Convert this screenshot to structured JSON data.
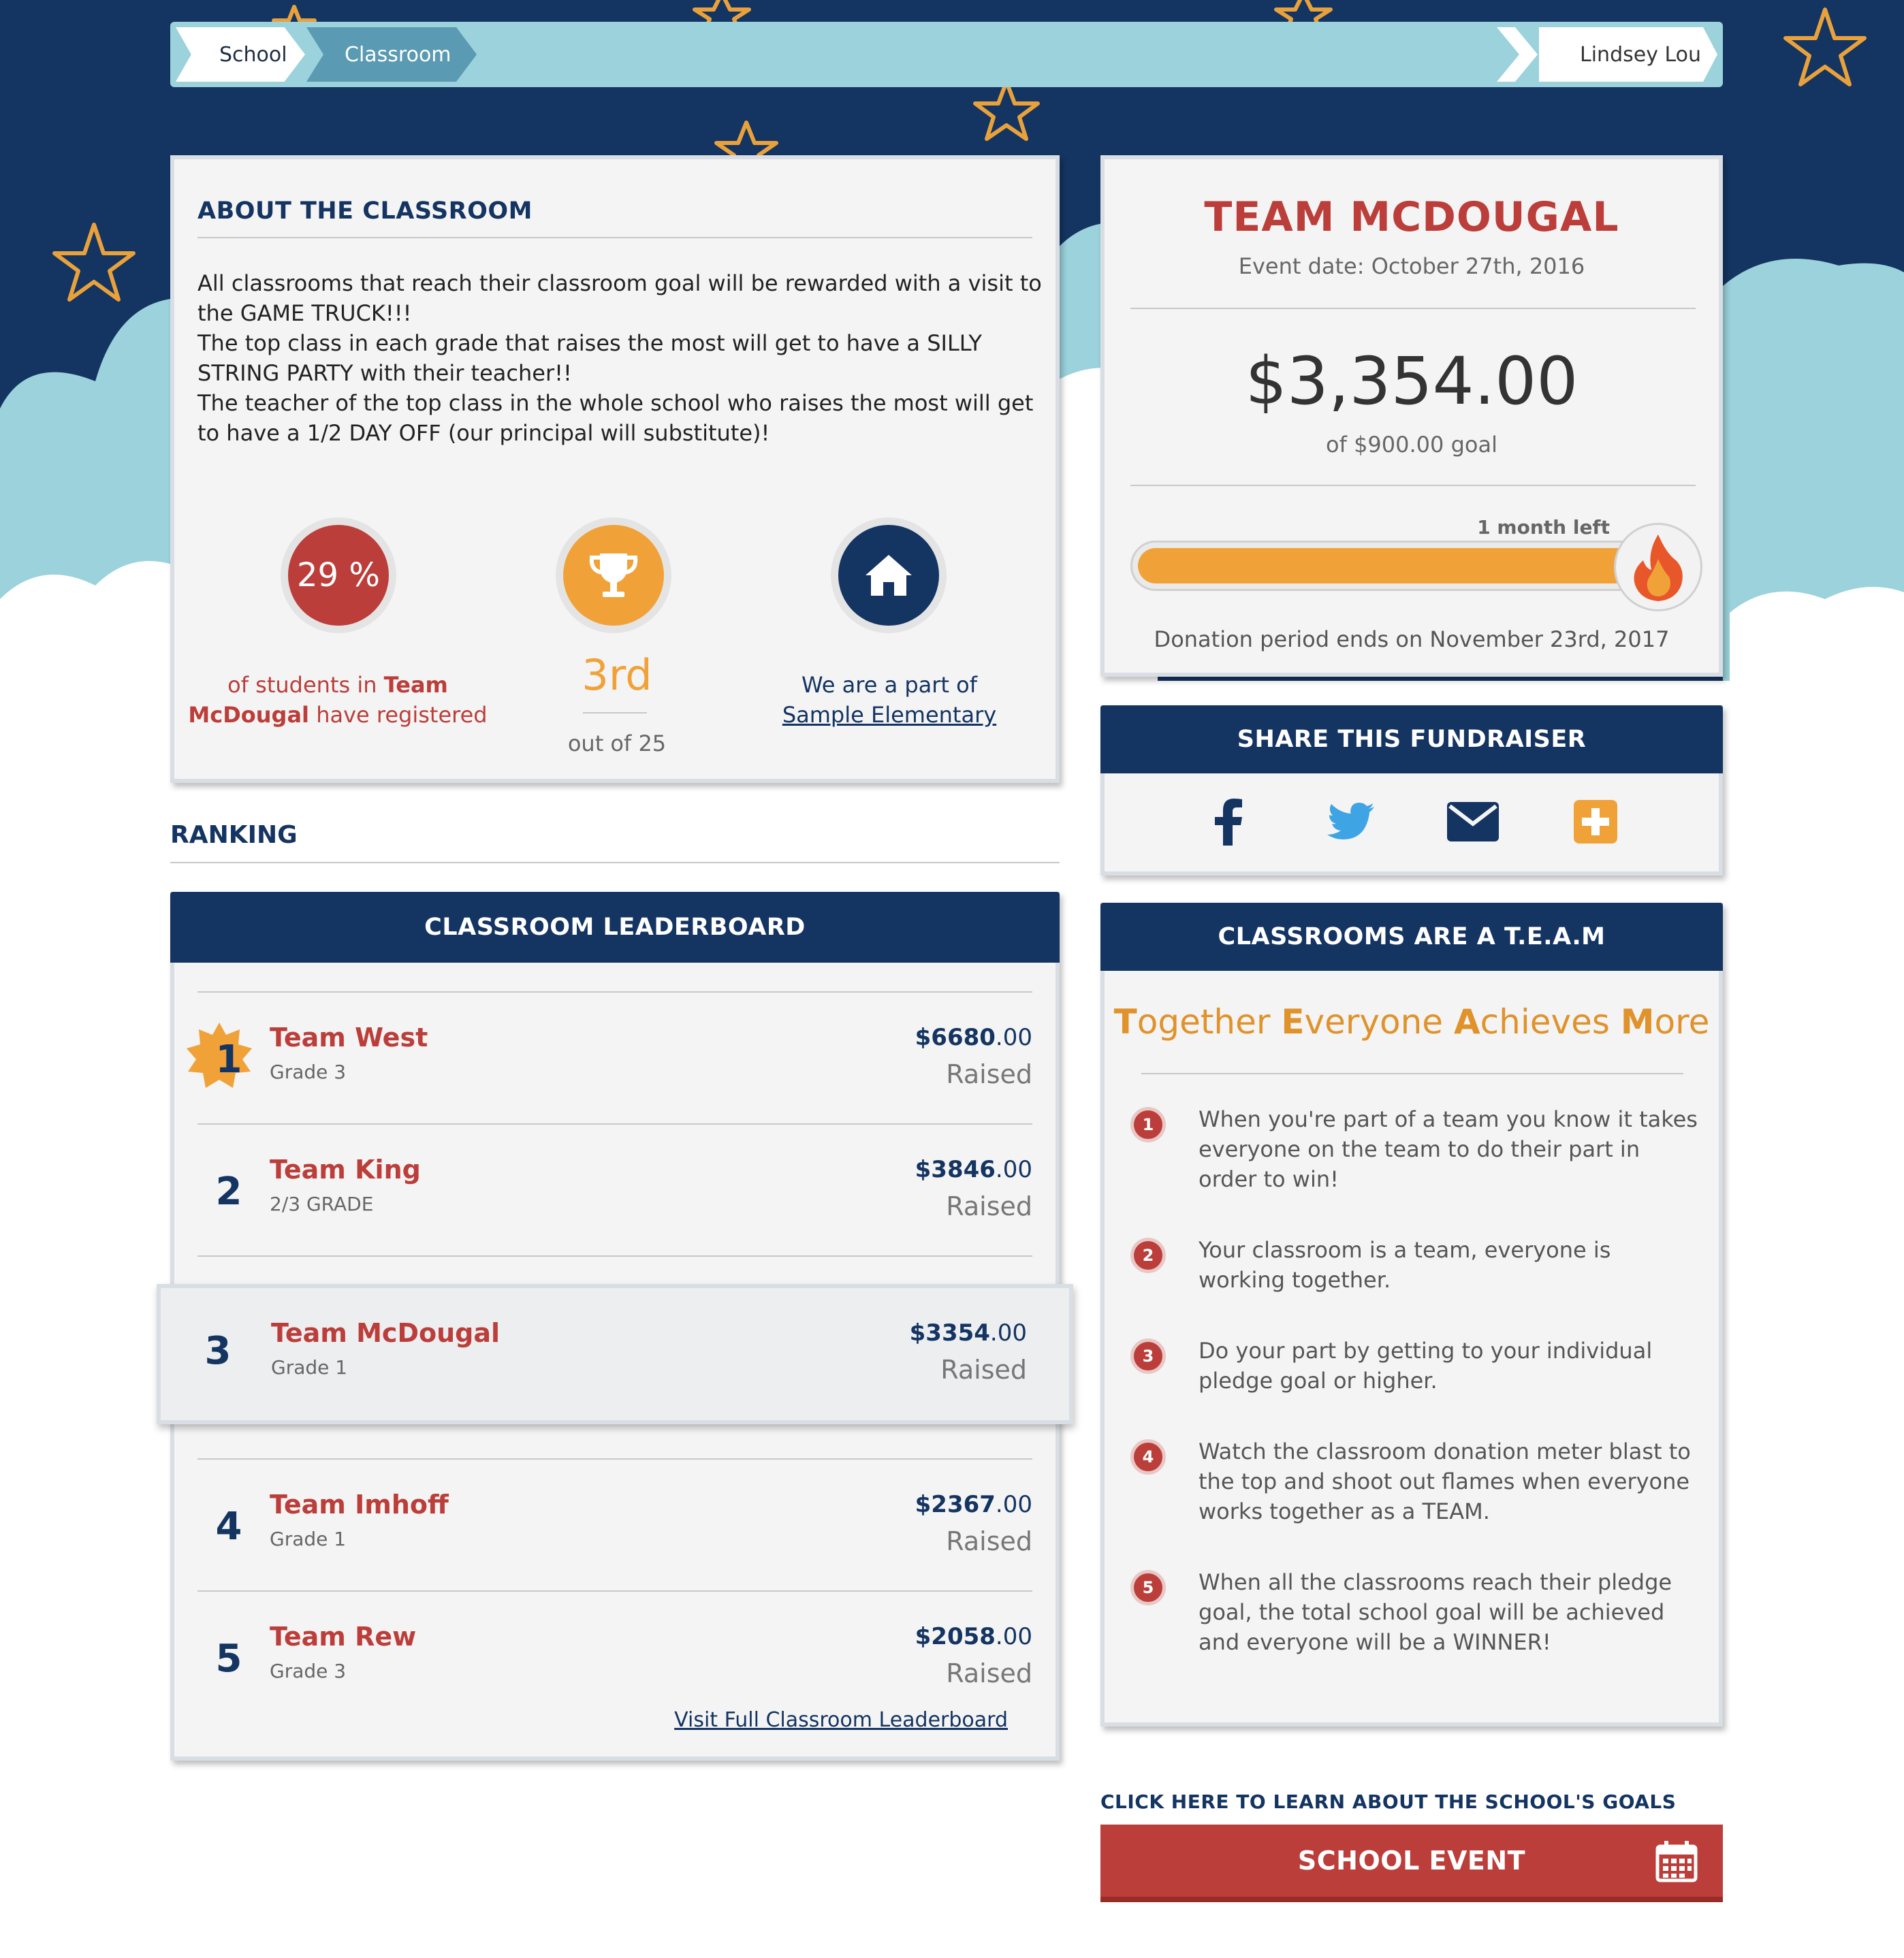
{
  "breadcrumb": {
    "items": [
      "School",
      "Classroom"
    ],
    "user": "Lindsey Lou"
  },
  "about": {
    "title": "ABOUT THE CLASSROOM",
    "paragraphs": [
      "All classrooms that reach their classroom goal will be rewarded with a visit to the GAME TRUCK!!!",
      "The top class in each grade that raises the most will get to have a SILLY STRING PARTY with their teacher!!",
      "The teacher of the top class in the whole school who raises the most will get to have a 1/2 DAY OFF (our principal will substitute)!"
    ],
    "stats": {
      "registered_percent": "29 %",
      "registered_caption_pre": "of students in ",
      "registered_caption_team": "Team McDougal",
      "registered_caption_post": " have registered",
      "rank": "3rd",
      "rank_of": "out of 25",
      "part_of_label": "We are a part of",
      "school_link": "Sample Elementary"
    }
  },
  "ranking": {
    "title": "RANKING",
    "leaderboard_title": "CLASSROOM LEADERBOARD",
    "rows": [
      {
        "rank": "1",
        "name": "Team West",
        "grade": "Grade 3",
        "amount_whole": "$6680",
        "amount_cents": ".00",
        "raised": "Raised"
      },
      {
        "rank": "2",
        "name": "Team King",
        "grade": "2/3 GRADE",
        "amount_whole": "$3846",
        "amount_cents": ".00",
        "raised": "Raised"
      },
      {
        "rank": "3",
        "name": "Team McDougal",
        "grade": "Grade 1",
        "amount_whole": "$3354",
        "amount_cents": ".00",
        "raised": "Raised"
      },
      {
        "rank": "4",
        "name": "Team Imhoff",
        "grade": "Grade 1",
        "amount_whole": "$2367",
        "amount_cents": ".00",
        "raised": "Raised"
      },
      {
        "rank": "5",
        "name": "Team Rew",
        "grade": "Grade 3",
        "amount_whole": "$2058",
        "amount_cents": ".00",
        "raised": "Raised"
      }
    ],
    "full_link": "Visit Full Classroom Leaderboard"
  },
  "team": {
    "title": "TEAM MCDOUGAL",
    "event_date": "Event date: October 27th, 2016",
    "amount": "$3,354.00",
    "goal": "of $900.00 goal",
    "time_left": "1 month left",
    "progress_percent": 100,
    "donation_end": "Donation period ends on November 23rd, 2017"
  },
  "share": {
    "title": "SHARE THIS FUNDRAISER",
    "icons": [
      "facebook-icon",
      "twitter-icon",
      "email-icon",
      "plus-icon"
    ]
  },
  "team_values": {
    "title": "CLASSROOMS ARE A T.E.A.M",
    "tagline_letters": [
      "T",
      "E",
      "A",
      "M"
    ],
    "tagline_rest": [
      "ogether ",
      "veryone ",
      "chieves ",
      "ore"
    ],
    "items": [
      {
        "num": "1",
        "text": "When you're part of a team you know it takes everyone on the team to do their part in order to win!"
      },
      {
        "num": "2",
        "text": "Your classroom is a team, everyone is working together."
      },
      {
        "num": "3",
        "text": "Do your part by getting to your individual pledge goal or higher."
      },
      {
        "num": "4",
        "text": "Watch the classroom donation meter blast to the top and shoot out flames when everyone works together as a TEAM."
      },
      {
        "num": "5",
        "text": "When all the classrooms reach their pledge goal, the total school goal will be achieved and everyone will be a WINNER!"
      }
    ]
  },
  "cta": {
    "label": "CLICK HERE TO LEARN ABOUT THE SCHOOL'S GOALS",
    "button": "SCHOOL EVENT"
  },
  "colors": {
    "navy": "#143462",
    "red": "#bb3e3a",
    "orange": "#f0a238",
    "sky_light": "#9bd2db"
  }
}
